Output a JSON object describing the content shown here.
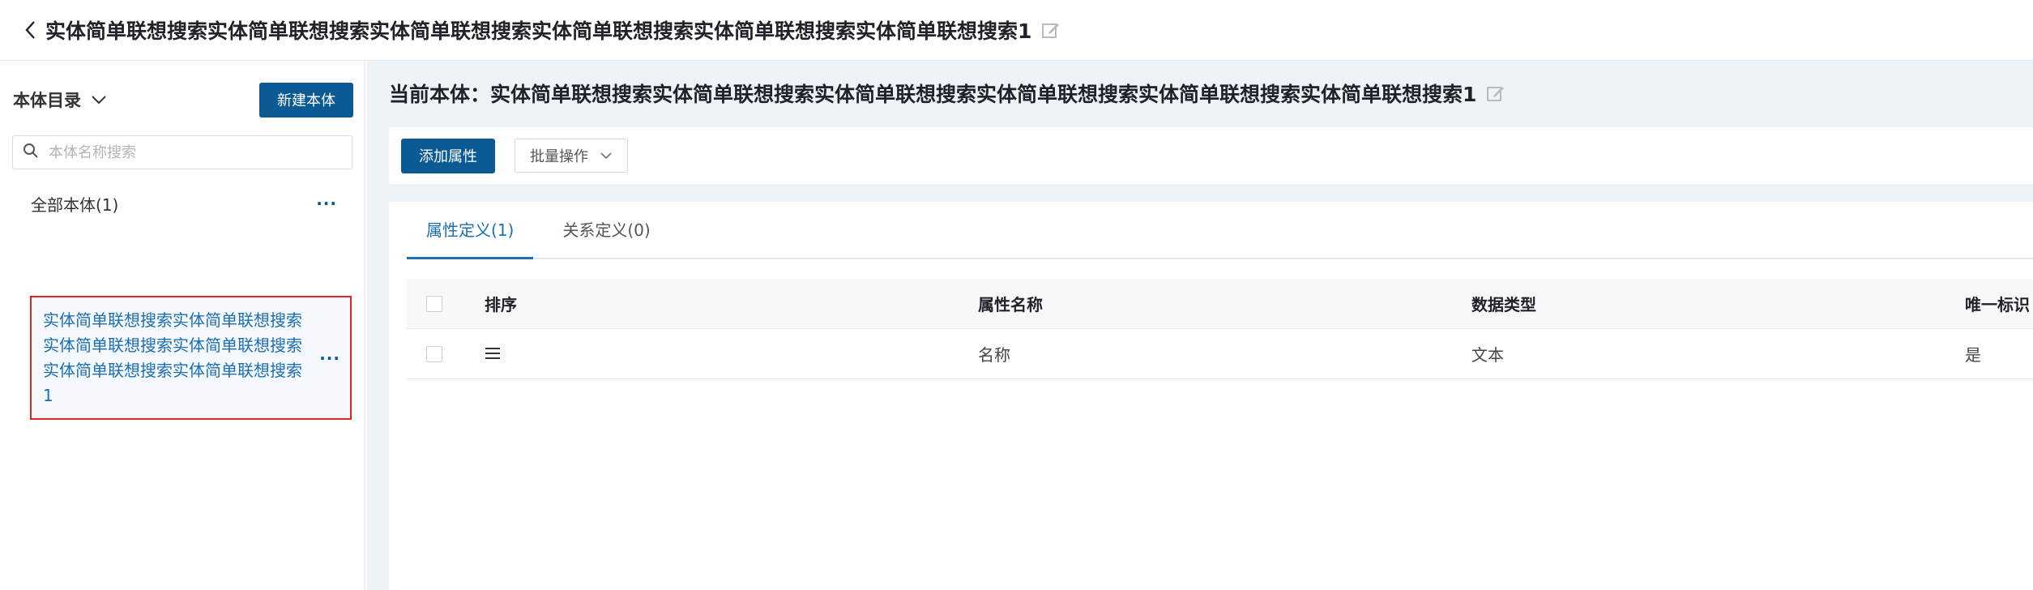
{
  "header": {
    "title": "实体简单联想搜索实体简单联想搜索实体简单联想搜索实体简单联想搜索实体简单联想搜索实体简单联想搜索1"
  },
  "sidebar": {
    "title": "本体目录",
    "new_button": "新建本体",
    "search_placeholder": "本体名称搜索",
    "all_label": "全部本体(1)",
    "items": [
      {
        "label": "实体简单联想搜索实体简单联想搜索实体简单联想搜索实体简单联想搜索实体简单联想搜索实体简单联想搜索1"
      }
    ]
  },
  "main": {
    "current_prefix": "当前本体：",
    "current_name": "实体简单联想搜索实体简单联想搜索实体简单联想搜索实体简单联想搜索实体简单联想搜索实体简单联想搜索1",
    "add_button": "添加属性",
    "batch_button": "批量操作",
    "tabs": [
      {
        "label": "属性定义(1)"
      },
      {
        "label": "关系定义(0)"
      }
    ],
    "table": {
      "columns": [
        "排序",
        "属性名称",
        "数据类型",
        "唯一标识"
      ],
      "rows": [
        {
          "name": "名称",
          "type": "文本",
          "unique": "是"
        }
      ]
    }
  },
  "colors": {
    "primary": "#0b5a94",
    "link": "#1b6fb3",
    "selected_border": "#e02424",
    "background": "#eef3f8"
  },
  "icons": [
    "back-icon",
    "edit-icon",
    "chevron-down-icon",
    "search-icon",
    "more-icon",
    "drag-handle-icon"
  ]
}
